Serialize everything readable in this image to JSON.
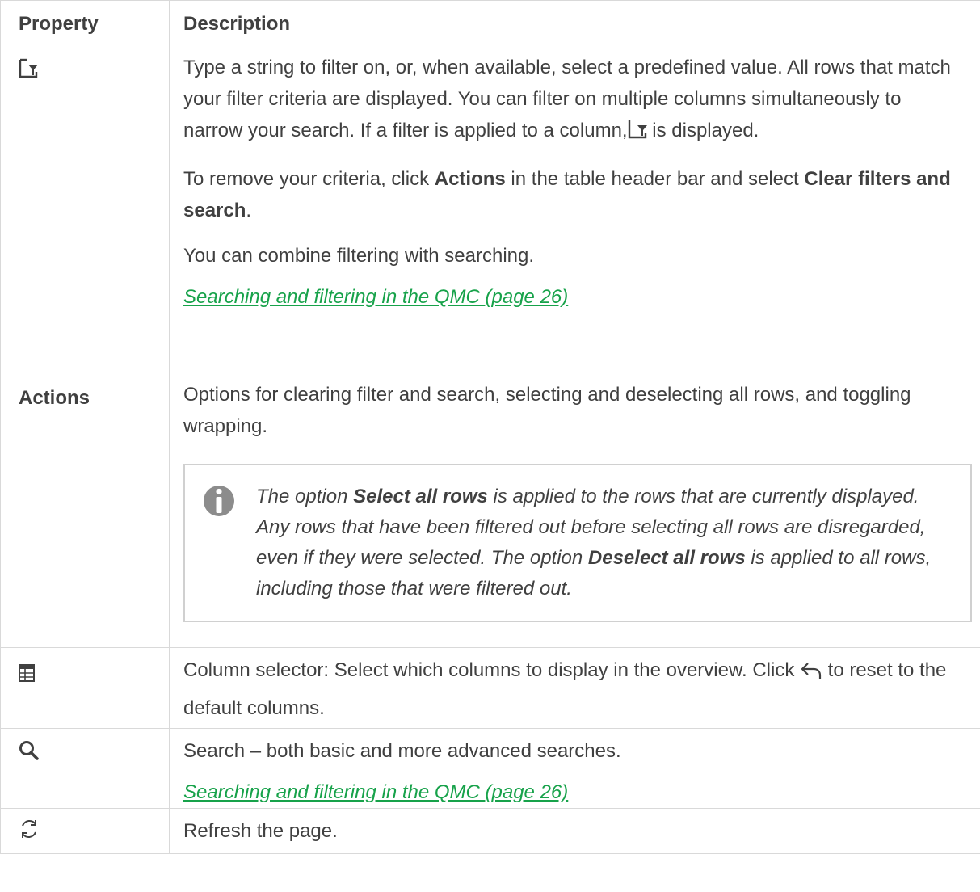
{
  "headers": {
    "property": "Property",
    "description": "Description"
  },
  "rows": {
    "filter": {
      "icon": "filter-icon",
      "desc_p1_a": "Type a string to filter on, or, when available, select a predefined value. All rows that match your filter criteria are displayed. You can filter on multiple columns simultaneously to narrow your search. If a filter is applied to a column,",
      "desc_p1_b": " is displayed.",
      "desc_p2_a": "To remove your criteria, click ",
      "desc_p2_actions": "Actions",
      "desc_p2_b": " in the table header bar and select ",
      "desc_p2_clear": "Clear filters and search",
      "desc_p2_c": ".",
      "desc_p3": "You can combine filtering with searching.",
      "link": " Searching and filtering in the QMC (page 26)"
    },
    "actions": {
      "label": "Actions",
      "desc": "Options for clearing filter and search, selecting and deselecting all rows, and toggling wrapping.",
      "note_icon": "info-icon",
      "note_a": "The option ",
      "note_select_all": "Select all rows",
      "note_b": " is applied to the rows that are currently displayed. Any rows that have been filtered out before selecting all rows are disregarded, even if they were selected. The option ",
      "note_deselect_all": "Deselect all rows",
      "note_c": " is applied to all rows, including those that were filtered out."
    },
    "columns": {
      "icon": "column-selector-icon",
      "desc_a": "Column selector: Select which columns to display in the overview. Click ",
      "reset_icon": "undo-arrow-icon",
      "desc_b": " to reset to the default columns."
    },
    "search": {
      "icon": "search-icon",
      "desc": "Search – both basic and more advanced searches.",
      "link": " Searching and filtering in the QMC (page 26)"
    },
    "refresh": {
      "icon": "refresh-icon",
      "desc": "Refresh the page."
    }
  }
}
